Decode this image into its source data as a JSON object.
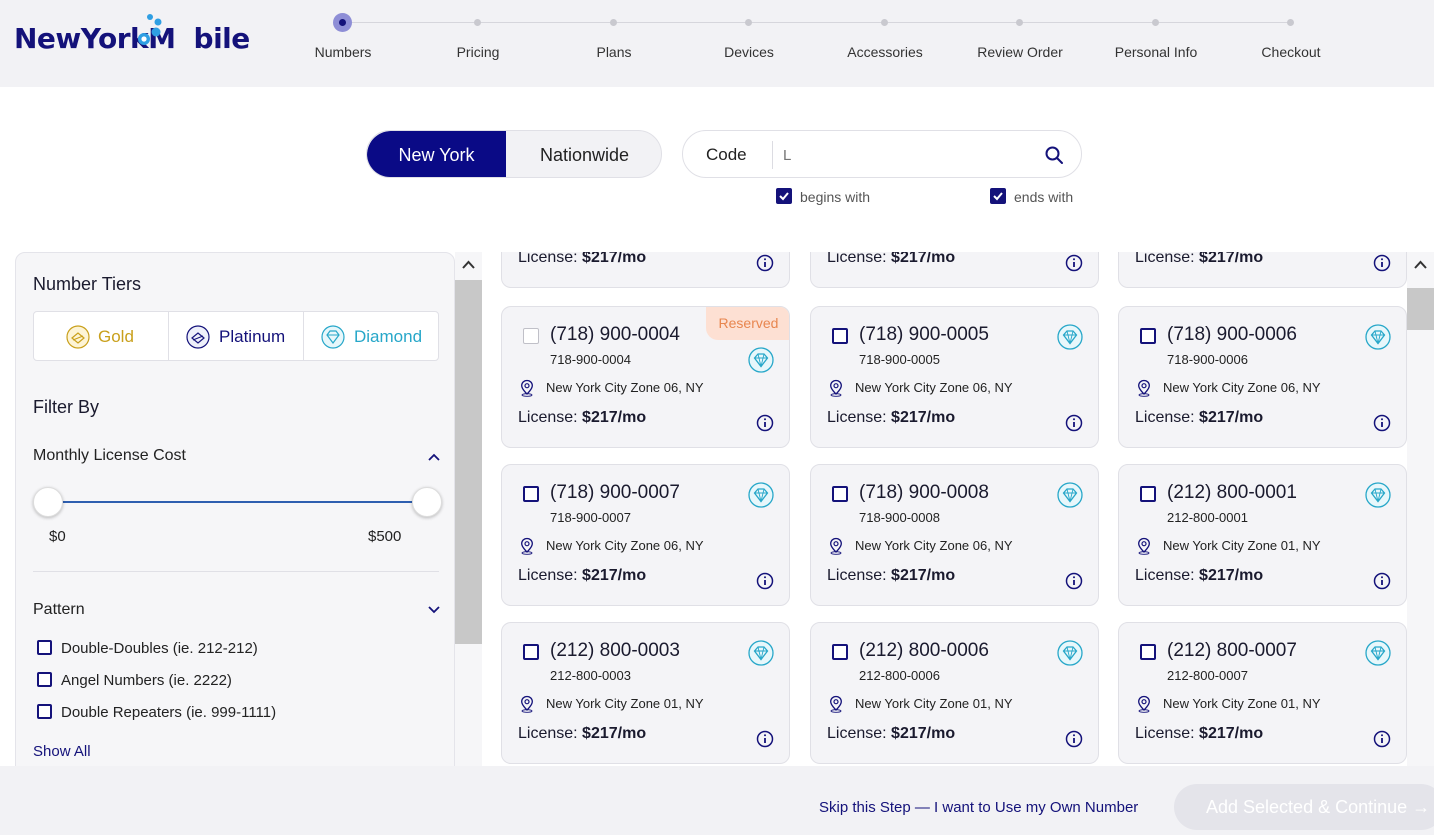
{
  "logo": {
    "text_main": "NewYorkM",
    "text_end": "bile"
  },
  "steps": [
    {
      "label": "Numbers",
      "active": true
    },
    {
      "label": "Pricing"
    },
    {
      "label": "Plans"
    },
    {
      "label": "Devices"
    },
    {
      "label": "Accessories"
    },
    {
      "label": "Review Order"
    },
    {
      "label": "Personal Info"
    },
    {
      "label": "Checkout"
    }
  ],
  "search": {
    "region_options": [
      "New York",
      "Nationwide"
    ],
    "selected_region": "New York",
    "code_label": "Code",
    "placeholder": "L",
    "begins_with_label": "begins with",
    "begins_with_checked": true,
    "ends_with_label": "ends with",
    "ends_with_checked": true
  },
  "sidebar": {
    "tiers_title": "Number Tiers",
    "tiers": [
      {
        "label": "Gold",
        "color": "#c9a01c"
      },
      {
        "label": "Platinum",
        "color": "#14127a"
      },
      {
        "label": "Diamond",
        "color": "#27a7c9"
      }
    ],
    "filter_by": "Filter By",
    "monthly_cost_label": "Monthly License Cost",
    "range_min": "$0",
    "range_max": "$500",
    "pattern_label": "Pattern",
    "patterns": [
      {
        "label": "Double-Doubles (ie. 212-212)"
      },
      {
        "label": "Angel Numbers (ie. 2222)"
      },
      {
        "label": "Double Repeaters (ie. 999-1111)"
      }
    ],
    "show_all": "Show All"
  },
  "license_prefix": "License: ",
  "top_partial_cards": [
    {
      "license": "$217/mo"
    },
    {
      "license": "$217/mo"
    },
    {
      "license": "$217/mo"
    }
  ],
  "cards": [
    {
      "number": "(718) 900-0004",
      "sub": "718-900-0004",
      "location": "New York City Zone 06, NY",
      "license": "$217/mo",
      "reserved": "Reserved"
    },
    {
      "number": "(718) 900-0005",
      "sub": "718-900-0005",
      "location": "New York City Zone 06, NY",
      "license": "$217/mo"
    },
    {
      "number": "(718) 900-0006",
      "sub": "718-900-0006",
      "location": "New York City Zone 06, NY",
      "license": "$217/mo"
    },
    {
      "number": "(718) 900-0007",
      "sub": "718-900-0007",
      "location": "New York City Zone 06, NY",
      "license": "$217/mo"
    },
    {
      "number": "(718) 900-0008",
      "sub": "718-900-0008",
      "location": "New York City Zone 06, NY",
      "license": "$217/mo"
    },
    {
      "number": "(212) 800-0001",
      "sub": "212-800-0001",
      "location": "New York City Zone 01, NY",
      "license": "$217/mo"
    },
    {
      "number": "(212) 800-0003",
      "sub": "212-800-0003",
      "location": "New York City Zone 01, NY",
      "license": "$217/mo"
    },
    {
      "number": "(212) 800-0006",
      "sub": "212-800-0006",
      "location": "New York City Zone 01, NY",
      "license": "$217/mo"
    },
    {
      "number": "(212) 800-0007",
      "sub": "212-800-0007",
      "location": "New York City Zone 01, NY",
      "license": "$217/mo"
    }
  ],
  "footer": {
    "skip_label": "Skip this Step — I want to Use my Own Number",
    "continue_label": "Add Selected & Continue →"
  },
  "colors": {
    "brand": "#14127a",
    "accent": "#2f9fe3",
    "diamond": "#27a7c9",
    "gold": "#c9a01c",
    "reserved_bg": "#fde0d3",
    "reserved_text": "#e8864f"
  }
}
